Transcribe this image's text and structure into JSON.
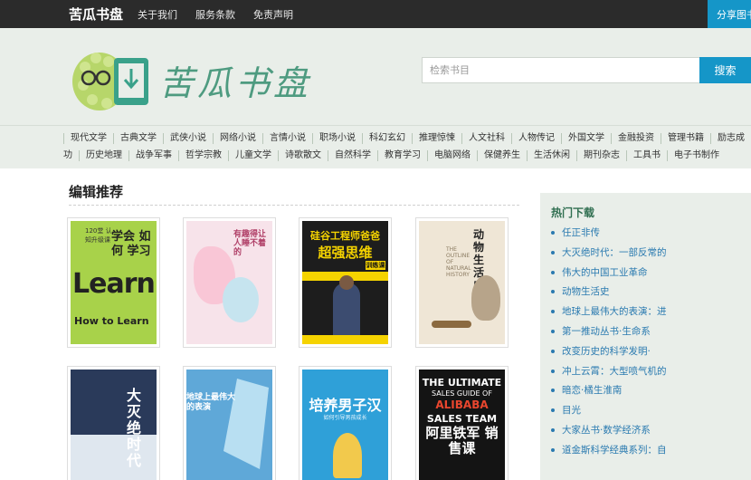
{
  "topbar": {
    "brand": "苦瓜书盘",
    "nav": [
      "关于我们",
      "服务条款",
      "免责声明"
    ],
    "share": "分享图书"
  },
  "header": {
    "logo_text": "苦瓜书盘",
    "search_placeholder": "检索书目",
    "search_button": "搜索"
  },
  "categories_row1": [
    "现代文学",
    "古典文学",
    "武侠小说",
    "网络小说",
    "言情小说",
    "职场小说",
    "科幻玄幻",
    "推理惊悚",
    "人文社科",
    "人物传记",
    "外国文学",
    "金融投资",
    "管理书籍",
    "励志成"
  ],
  "categories_row2": [
    "功",
    "历史地理",
    "战争军事",
    "哲学宗教",
    "儿童文学",
    "诗歌散文",
    "自然科学",
    "教育学习",
    "电脑网络",
    "保健养生",
    "生活休闲",
    "期刊杂志",
    "工具书",
    "电子书制作"
  ],
  "main": {
    "section_title": "编辑推荐"
  },
  "books": {
    "b1": {
      "sub": "120堂 认知升级课",
      "title": "学会 如何 学习",
      "big": "Learn",
      "line": "How to Learn"
    },
    "b2": {
      "title": "有趣得让人睡不着的"
    },
    "b3": {
      "top": "硅谷工程师爸爸",
      "title": "超强思维",
      "tag": "训练课"
    },
    "b4": {
      "title": "动物生活史",
      "en": "THE OUTLINE OF NATURAL HISTORY"
    },
    "b5": {
      "title": "大灭绝时代"
    },
    "b6": {
      "title": "地球上最伟大的表演"
    },
    "b7": {
      "title": "培养男子汉",
      "sub": "如何引导男孩成长"
    },
    "b8": {
      "en1": "THE ULTIMATE",
      "en2": "SALES GUIDE OF",
      "en3": "ALIBABA",
      "en4": "SALES TEAM",
      "title": "阿里铁军 销售课"
    }
  },
  "sidebar": {
    "title": "热门下载",
    "items": [
      "任正非传",
      "大灭绝时代：一部反常的",
      "伟大的中国工业革命",
      "动物生活史",
      "地球上最伟大的表演：进",
      "第一推动丛书·生命系",
      "改变历史的科学发明·",
      "冲上云霄：大型喷气机的",
      "暗恋·橘生淮南",
      "目光",
      "大家丛书·数学经济系",
      "道金斯科学经典系列：自"
    ]
  }
}
